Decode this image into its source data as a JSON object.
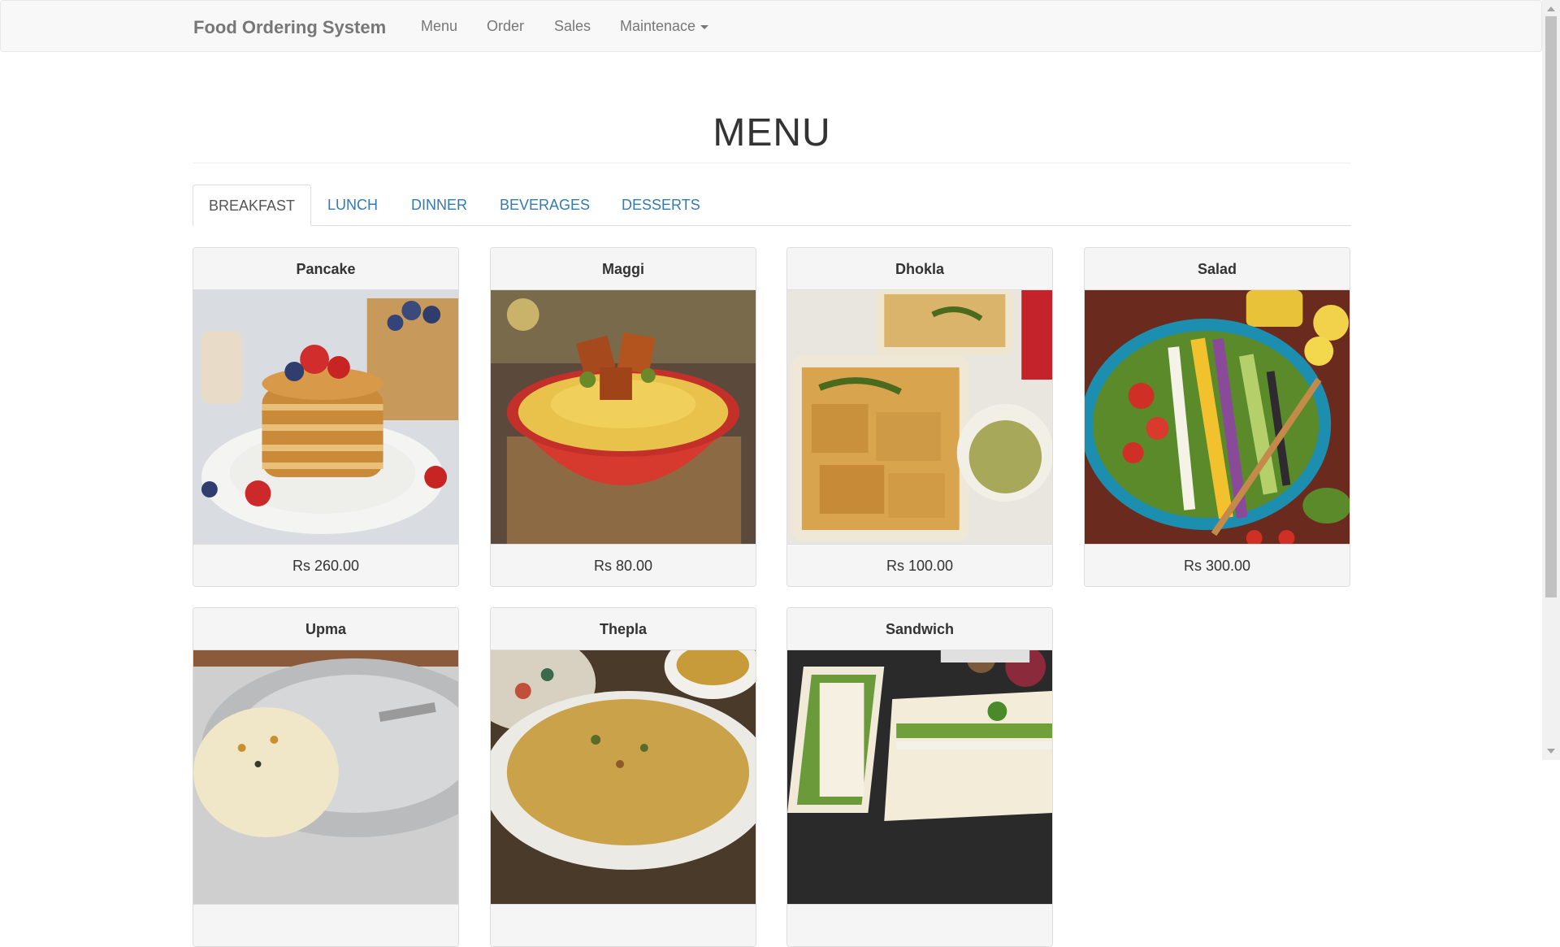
{
  "nav": {
    "brand": "Food Ordering System",
    "links": [
      "Menu",
      "Order",
      "Sales"
    ],
    "dropdown": "Maintenace"
  },
  "page": {
    "title": "MENU"
  },
  "tabs": [
    "BREAKFAST",
    "LUNCH",
    "DINNER",
    "BEVERAGES",
    "DESSERTS"
  ],
  "items": [
    {
      "name": "Pancake",
      "price": "Rs 260.00"
    },
    {
      "name": "Maggi",
      "price": "Rs 80.00"
    },
    {
      "name": "Dhokla",
      "price": "Rs 100.00"
    },
    {
      "name": "Salad",
      "price": "Rs 300.00"
    },
    {
      "name": "Upma",
      "price": ""
    },
    {
      "name": "Thepla",
      "price": ""
    },
    {
      "name": "Sandwich",
      "price": ""
    }
  ],
  "colors": {
    "link": "#337ab7",
    "navbar_bg": "#f8f8f8",
    "panel_bg": "#f5f5f5"
  }
}
